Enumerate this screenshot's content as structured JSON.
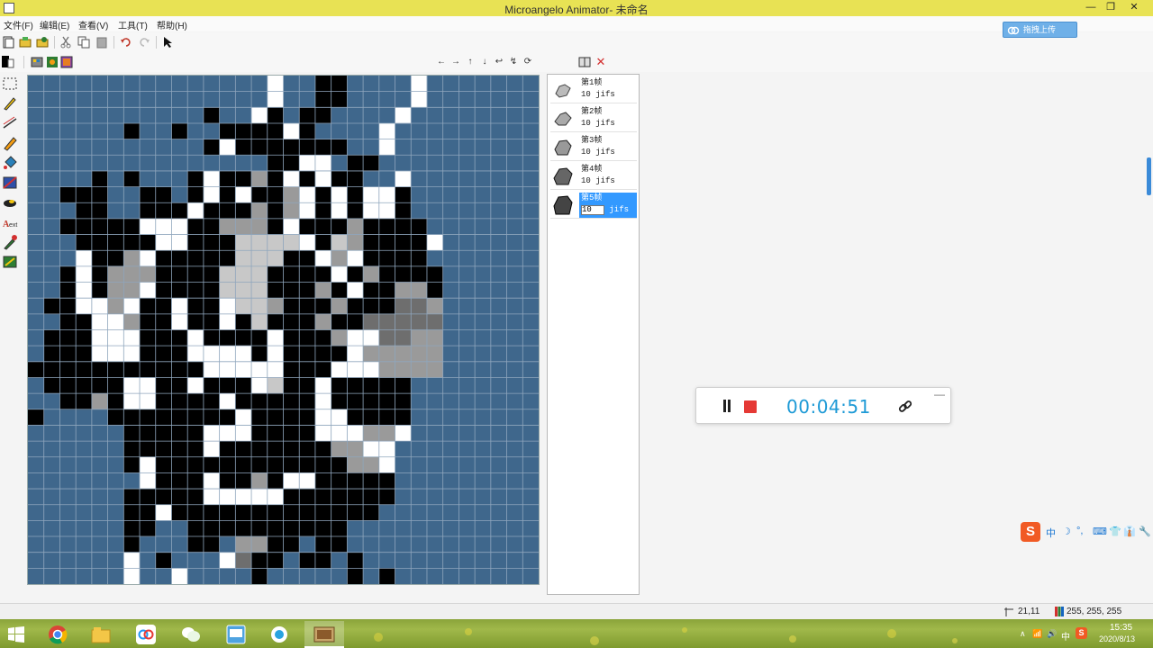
{
  "window": {
    "title": "Microangelo Animator- 未命名",
    "minimize": "—",
    "maximize": "❐",
    "close": "✕"
  },
  "menu": {
    "items": [
      "文件(F)",
      "编辑(E)",
      "查看(V)",
      "工具(T)",
      "帮助(H)"
    ]
  },
  "upload_button": "拖拽上传",
  "frames": [
    {
      "label": "第1帧",
      "duration": "10 jifs",
      "selected": false
    },
    {
      "label": "第2帧",
      "duration": "10 jifs",
      "selected": false
    },
    {
      "label": "第3帧",
      "duration": "10 jifs",
      "selected": false
    },
    {
      "label": "第4帧",
      "duration": "10 jifs",
      "selected": false
    },
    {
      "label": "第5帧",
      "duration_value": "10",
      "duration_unit": "jifs",
      "selected": true
    }
  ],
  "recorder": {
    "time": "00:04:51",
    "minimize": "—"
  },
  "ime": {
    "logo": "S",
    "items": [
      "中",
      "☽",
      "°,",
      "⌨",
      "👕",
      "👔",
      "🔧"
    ]
  },
  "status": {
    "coords": "21,11",
    "rgb": "255, 255, 255"
  },
  "clock": {
    "time": "15:35",
    "date": "2020/8/13"
  },
  "tray": {
    "ime": "中",
    "icons": [
      "∧",
      "📶",
      "🔊"
    ]
  },
  "colors": {
    "canvas_bg": "#3f678c",
    "grid_line": "#8fa6bd",
    "black": "#000000",
    "white": "#ffffff",
    "light_gray": "#c8c8c8",
    "mid_gray": "#9a9a9a",
    "dark_gray": "#6e6e6e",
    "titlebar": "#e8e254",
    "selected_frame": "#3399ff",
    "timer": "#1e9ad6",
    "stop": "#e53935"
  },
  "canvas": {
    "grid_cols": 32,
    "grid_rows": 32,
    "palette": [
      ".",
      "B",
      "W",
      "L",
      "M",
      "D"
    ],
    "rows": [
      "...............W..BB....W.......",
      "...............W..BB....W.......",
      "...........B..WB.BB....W........",
      "......B..B..BBBBWB....W.........",
      "...........BWBBBBBBB..W.........",
      "...............BBWW.BB..........",
      "....B.B...BWBBMBWBWBB..W........",
      "..BBB..BB.BWBWBBMWBWBWWB........",
      "...BB..BBBWBBBMBMWBWBWWB........",
      "..BBBBBWWWBBMMMBWBBBMBBBB.......",
      "...BBBBBWWBBBLLLLWBLMBBBBW......",
      "...WBBMWBBBBBLLLBBWMWBBBB.......",
      "..BWBMMMBBBBLLLBBBBWBMBBBB......",
      "..BWBMMWBBBBLLLBBBMBWBBMMB......",
      ".BBWWMWBBWBBWLLMBBBMBBBDDM......",
      "..BBWWMBBWBBWBLBBBMBBDDDDD......",
      ".BBBWWWBBBWBBBBWBBBMWWDDMM......",
      ".BBBWWWBBBWWWWBWBBBBWMMMMM......",
      "BBBBBBBBBBBWWWWWBBBWWWMMMM......",
      ".BBBBBWWBBWBBBWLBBWBBBBB........",
      "..BBMBWWBBBBWBBBBBWBBBBB........",
      "B....BBBBBBBBWBBBBWWBBBB........",
      "......BBBBBWWWBBBBWWWMMW........",
      "......BBBBBWBBBBBBBMMWW.........",
      "......BWBBBBBBBBBBBBMMW.........",
      ".......WBBBWBBMBWWBBBBB.........",
      "......BBBBBWWWWWBBBBBBB.........",
      "......BBWBBBBBBBBBBBBB..........",
      "......BB..BBBBBBBBBB............",
      "......B...BB.MMBB.BB............",
      "......W.B...WDBB.BB.B...........",
      "......W..W....B.....B.B........."
    ]
  }
}
